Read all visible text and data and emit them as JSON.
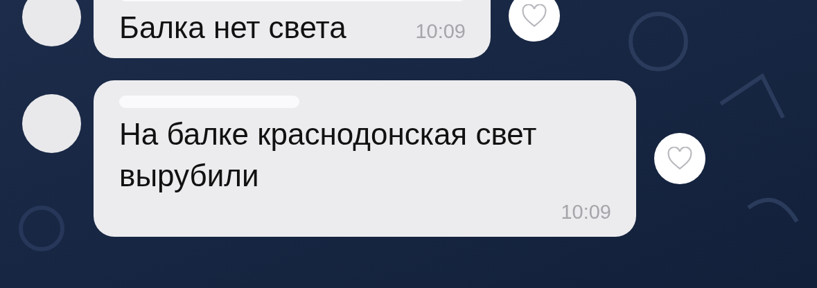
{
  "messages": [
    {
      "name_hidden": true,
      "text": "Балка нет света",
      "time": "10:09",
      "liked": false
    },
    {
      "name_hidden": true,
      "text": "На балке краснодонская свет вырубили",
      "time": "10:09",
      "liked": false
    }
  ]
}
